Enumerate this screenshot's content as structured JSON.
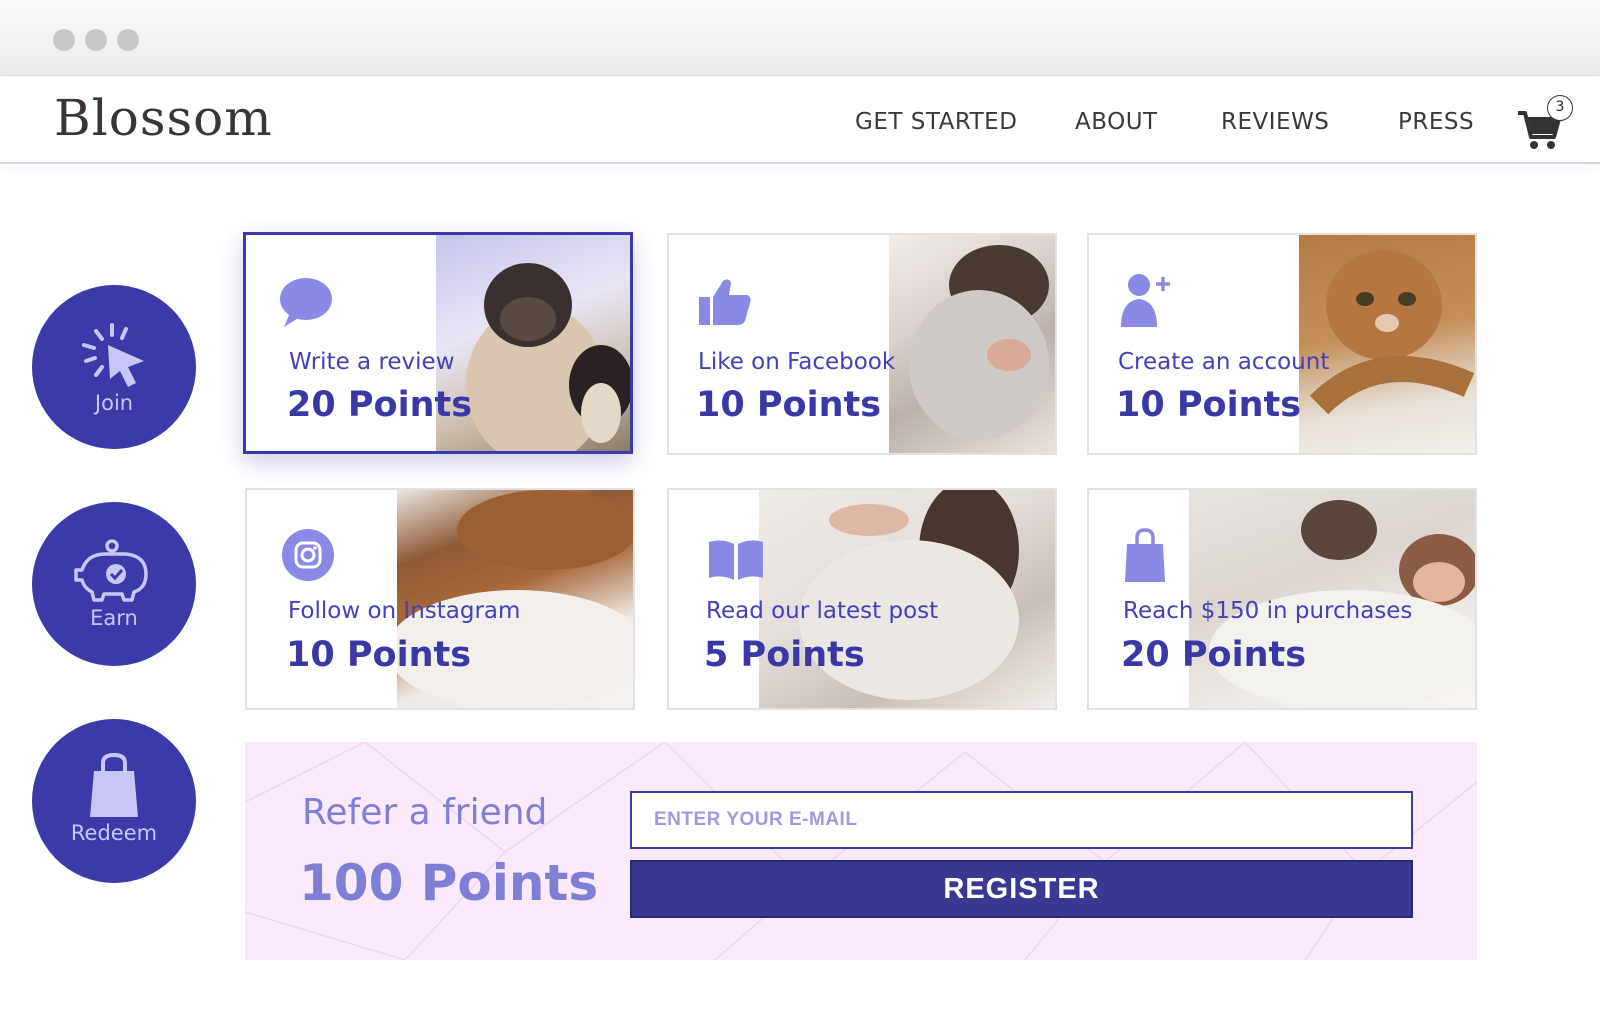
{
  "header": {
    "logo": "Blossom",
    "nav": [
      "GET STARTED",
      "ABOUT",
      "REVIEWS",
      "PRESS"
    ],
    "cart_count": "3"
  },
  "steps": [
    {
      "label": "Join",
      "icon": "cursor-click-icon"
    },
    {
      "label": "Earn",
      "icon": "piggy-bank-icon"
    },
    {
      "label": "Redeem",
      "icon": "shopping-bag-icon"
    }
  ],
  "cards": [
    {
      "title": "Write a review",
      "points": "20 Points",
      "icon": "speech-bubble-icon",
      "photo": "dogs-photo"
    },
    {
      "title": "Like on Facebook",
      "points": "10 Points",
      "icon": "thumbs-up-icon",
      "photo": "pillow-hug-photo"
    },
    {
      "title": "Create an account",
      "points": "10 Points",
      "icon": "add-user-icon",
      "photo": "cat-photo"
    },
    {
      "title": "Follow on Instagram",
      "points": "10 Points",
      "icon": "instagram-icon",
      "photo": "bed-lounging-photo"
    },
    {
      "title": "Read our latest post",
      "points": "5 Points",
      "icon": "open-book-icon",
      "photo": "pillow-photo"
    },
    {
      "title": "Reach $150 in purchases",
      "points": "20 Points",
      "icon": "shopping-bag-icon",
      "photo": "couple-bed-photo"
    }
  ],
  "refer": {
    "title": "Refer a friend",
    "points": "100 Points",
    "email_placeholder": "ENTER YOUR E-MAIL",
    "register_label": "REGISTER"
  },
  "colors": {
    "primary": "#3c3aa8",
    "primary_light": "#8a8ae6",
    "refer_bg": "#fbeafb",
    "register_bg": "#3a3891"
  }
}
